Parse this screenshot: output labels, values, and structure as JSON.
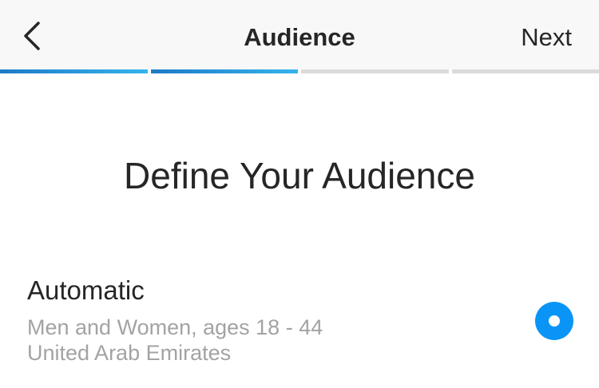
{
  "header": {
    "title": "Audience",
    "next_label": "Next",
    "back_icon": "chevron-left-icon"
  },
  "progress": {
    "total_steps": 4,
    "completed_steps": 2,
    "colors": {
      "complete_start": "#1f7ac8",
      "complete_end": "#35b4ec",
      "incomplete": "#dbdbdb"
    }
  },
  "main": {
    "heading": "Define Your Audience",
    "options": [
      {
        "title": "Automatic",
        "line1": "Men and Women, ages 18 - 44",
        "line2": "United Arab Emirates",
        "selected": true
      }
    ]
  },
  "colors": {
    "accent": "#0a95f6",
    "text_primary": "#262626",
    "text_secondary": "#a3a3a3",
    "nav_background": "#f8f8f8"
  }
}
